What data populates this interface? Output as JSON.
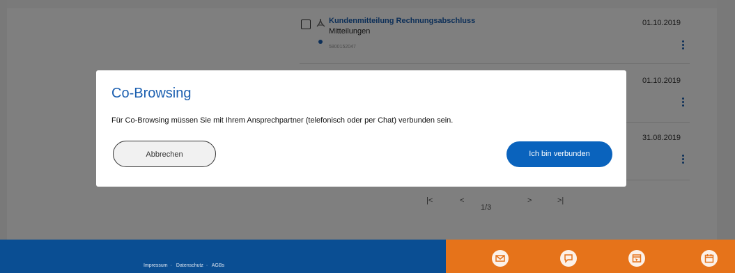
{
  "documents": [
    {
      "title": "Kundenmitteilung Rechnungsabschluss",
      "category": "Mitteilungen",
      "number": "5800152047",
      "date": "01.10.2019"
    },
    {
      "date": "01.10.2019"
    },
    {
      "date": "31.08.2019"
    }
  ],
  "pagination": {
    "first": "|<",
    "prev": "<",
    "current": "1/3",
    "next": ">",
    "last": ">|"
  },
  "modal": {
    "title": "Co-Browsing",
    "message": "Für Co-Browsing müssen Sie mit Ihrem Ansprechpartner (telefonisch oder per Chat) verbunden sein.",
    "cancel_label": "Abbrechen",
    "confirm_label": "Ich bin verbunden"
  },
  "footer": {
    "links": [
      "Impressum",
      "Datenschutz",
      "AGBs"
    ],
    "separator": "·",
    "icons": [
      "mail-icon",
      "chat-icon",
      "co-browsing-icon",
      "calendar-icon"
    ]
  },
  "colors": {
    "brand_blue": "#0a4e93",
    "link_blue": "#1b5fb0",
    "button_blue": "#0a63bd",
    "footer_orange": "#e6731a",
    "overlay": "rgba(0,0,0,0.5)"
  }
}
